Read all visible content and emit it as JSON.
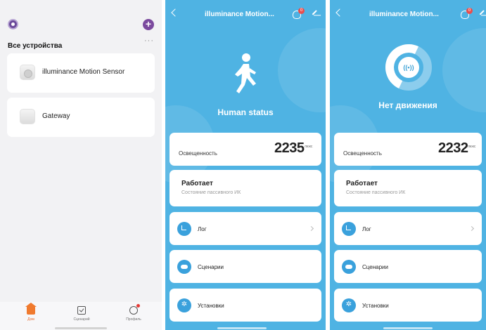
{
  "home": {
    "section_title": "Все устройства",
    "more_glyph": "···",
    "add_glyph": "+",
    "devices": [
      {
        "name": "illuminance Motion Sensor"
      },
      {
        "name": "Gateway"
      }
    ],
    "nav": [
      {
        "label": "Дом"
      },
      {
        "label": "Сценарий"
      },
      {
        "label": "Профиль"
      }
    ]
  },
  "details": [
    {
      "title": "illuminance Motion...",
      "badge": "0",
      "status": "Human status",
      "illuminance_label": "Освещенность",
      "illuminance_value": "2235",
      "illuminance_unit": "люкс",
      "pir_title": "Работает",
      "pir_subtitle": "Состояние пассивного ИК",
      "rows": [
        {
          "label": "Лог"
        },
        {
          "label": "Сценарии"
        },
        {
          "label": "Установки"
        }
      ]
    },
    {
      "title": "illuminance Motion...",
      "badge": "0",
      "status": "Нет движения",
      "motion_glyph": "((•))",
      "illuminance_label": "Освещенность",
      "illuminance_value": "2232",
      "illuminance_unit": "люкс",
      "pir_title": "Работает",
      "pir_subtitle": "Состояние пассивного ИК",
      "rows": [
        {
          "label": "Лог"
        },
        {
          "label": "Сценарии"
        },
        {
          "label": "Установки"
        }
      ]
    }
  ],
  "colors": {
    "accent_blue": "#4fb3e3",
    "brand_purple": "#7b4a9e",
    "home_orange": "#f07a2e"
  }
}
